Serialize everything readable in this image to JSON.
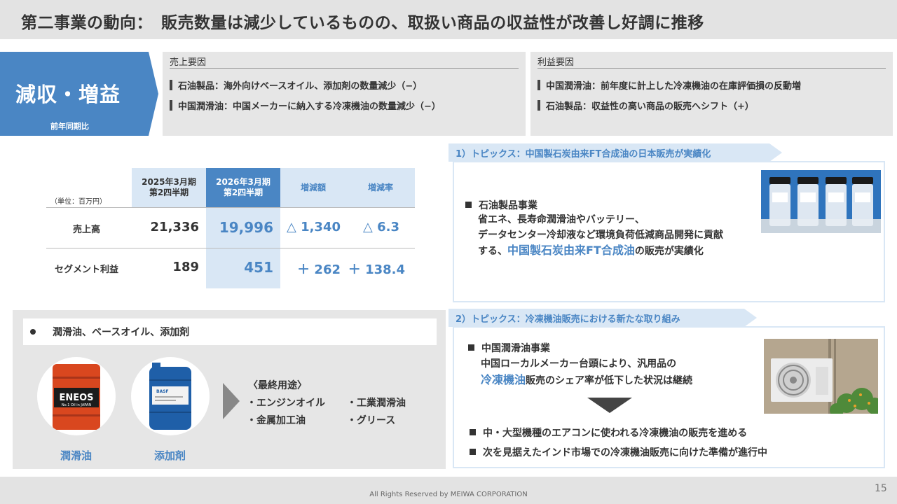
{
  "title": "第二事業の動向：　販売数量は減少しているものの、取扱い商品の収益性が改善し好調に推移",
  "badge": {
    "title": "減収・増益",
    "subtitle": "前年同期比"
  },
  "sales_factors": {
    "heading": "売上要因",
    "items": [
      "石油製品：海外向けベースオイル、添加剤の数量減少（−）",
      "中国潤滑油：中国メーカーに納入する冷凍機油の数量減少（−）"
    ]
  },
  "profit_factors": {
    "heading": "利益要因",
    "items": [
      "中国潤滑油：前年度に計上した冷凍機油の在庫評価損の反動増",
      "石油製品：収益性の高い商品の販売へシフト（+）"
    ]
  },
  "table": {
    "unit": "（単位：百万円）",
    "headers": {
      "prev": [
        "2025年3月期",
        "第2四半期"
      ],
      "curr": [
        "2026年3月期",
        "第2四半期"
      ],
      "diff": "増減額",
      "rate": "増減率"
    },
    "rows": [
      {
        "label": "売上高",
        "prev": "21,336",
        "curr": "19,996",
        "diff": "△ 1,340",
        "rate": "△ 6.3"
      },
      {
        "label": "セグメント利益",
        "prev": "189",
        "curr": "451",
        "diff": "＋ 262",
        "rate": "＋ 138.4"
      }
    ]
  },
  "products": {
    "heading": "潤滑油、ベースオイル、添加剤",
    "items": [
      {
        "caption": "潤滑油",
        "drum_brand": "ENEOS",
        "drum_sub": "No.1 Oil in JAPAN",
        "color": "#d9471f"
      },
      {
        "caption": "添加剤",
        "drum_brand": "BASF",
        "drum_sub": "",
        "color": "#1f5fa8"
      }
    ],
    "uses_heading": "〈最終用途〉",
    "uses": [
      "・エンジンオイル",
      "・工業潤滑油",
      "・金属加工油",
      "・グリース"
    ]
  },
  "topic1": {
    "tag": "1）トピックス：中国製石炭由来FT合成油の日本販売が実績化",
    "heading": "石油製品事業",
    "lines": [
      "省エネ、長寿命潤滑油やバッテリー、",
      "データセンター冷却液など環境負荷低減商品開発に貢献"
    ],
    "line3_pre": "する、",
    "line3_hl": "中国製石炭由来FT合成油",
    "line3_post": "の販売が実績化"
  },
  "topic2": {
    "tag": "2）トピックス：冷凍機油販売における新たな取り組み",
    "heading": "中国潤滑油事業",
    "line1": "中国ローカルメーカー台頭により、汎用品の",
    "line2_hl": "冷凍機油",
    "line2_post": "販売のシェア率が低下した状況は継続",
    "bullets": [
      "中・大型機種のエアコンに使われる冷凍機油の販売を進める",
      "次を見据えたインド市場での冷凍機油販売に向けた準備が進行中"
    ]
  },
  "footer": {
    "copyright": "All Rights Reserved by MEIWA CORPORATION",
    "page": "15"
  },
  "colors": {
    "accent": "#4a86c4",
    "light_accent": "#d9e7f5",
    "panel": "#e6e6e6"
  }
}
